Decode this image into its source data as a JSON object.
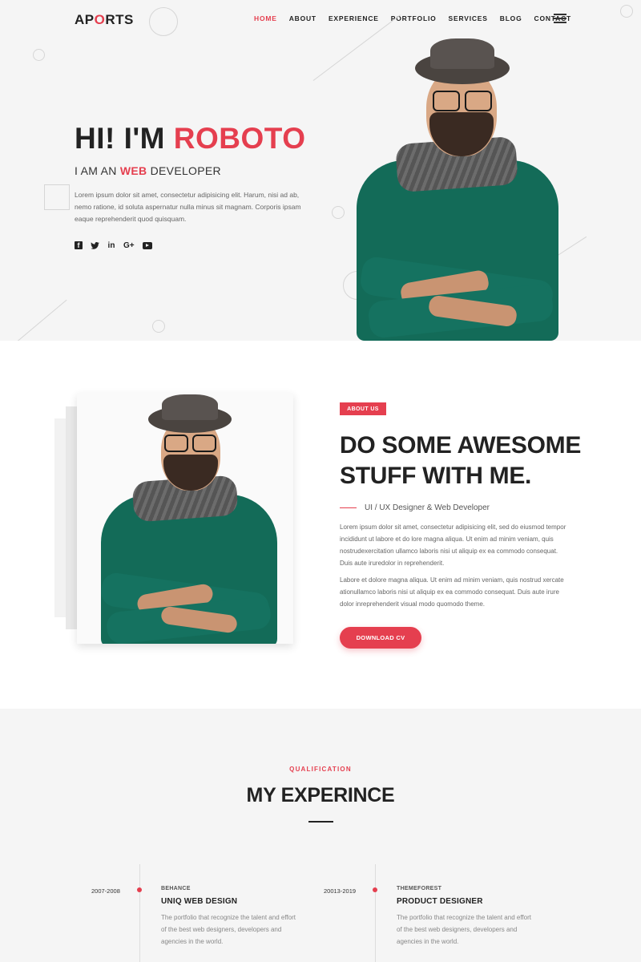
{
  "brand": {
    "logo_prefix": "AP",
    "logo_accent": "O",
    "logo_suffix": "RTS"
  },
  "nav": {
    "items": [
      "HOME",
      "ABOUT",
      "EXPERIENCE",
      "PORTFOLIO",
      "SERVICES",
      "BLOG",
      "CONTACT"
    ],
    "active": "HOME"
  },
  "hero": {
    "title_prefix": "HI! I'M ",
    "title_name": "ROBOTO",
    "subtitle_prefix": "I AM AN ",
    "subtitle_accent": "WEB",
    "subtitle_suffix": " DEVELOPER",
    "description": "Lorem ipsum dolor sit amet, consectetur adipisicing elit. Harum, nisi ad ab, nemo ratione, id soluta aspernatur nulla minus sit magnam. Corporis ipsam eaque reprehenderit quod quisquam.",
    "socials": [
      {
        "name": "facebook-icon",
        "glyph": "f"
      },
      {
        "name": "twitter-icon",
        "glyph": "🐦"
      },
      {
        "name": "linkedin-icon",
        "glyph": "in"
      },
      {
        "name": "google-plus-icon",
        "glyph": "G+"
      },
      {
        "name": "youtube-icon",
        "glyph": ""
      }
    ]
  },
  "about": {
    "tag": "ABOUT US",
    "heading": "DO SOME AWESOME STUFF WITH ME.",
    "role": "UI / UX Designer & Web Developer",
    "paragraph1": "Lorem ipsum dolor sit amet, consectetur adipisicing elit, sed do eiusmod tempor incididunt ut labore et do lore magna aliqua. Ut enim ad minim veniam, quis nostrudexercitation ullamco laboris nisi ut aliquip ex ea commodo consequat. Duis aute iruredolor in reprehenderit.",
    "paragraph2": "Labore et dolore magna aliqua. Ut enim ad minim veniam, quis nostrud xercate ationullamco laboris nisi ut aliquip ex ea commodo consequat. Duis aute irure dolor inreprehenderit visual modo quomodo theme.",
    "button": "DOWNLOAD CV"
  },
  "experience": {
    "kicker": "QUALIFICATION",
    "title": "MY EXPERINCE",
    "items": [
      {
        "years": "2007-2008",
        "company": "BEHANCE",
        "role": "UNIQ WEB DESIGN",
        "description": "The portfolio that recognize the talent and effort of the best web designers, developers and agencies in the world."
      },
      {
        "years": "20013-2019",
        "company": "THEMEFOREST",
        "role": "PRODUCT DESIGNER",
        "description": "The portfolio that recognize the talent and effort of the best web designers, developers and agencies in the world."
      }
    ]
  },
  "colors": {
    "accent": "#e53f4f",
    "sweater": "#136b58",
    "hero_bg": "#f5f5f5"
  }
}
